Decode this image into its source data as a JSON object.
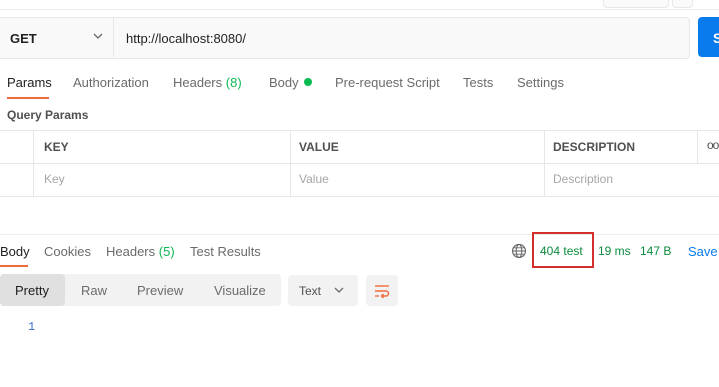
{
  "request": {
    "method": "GET",
    "url": "http://localhost:8080/",
    "send_label": "S"
  },
  "request_tabs": [
    {
      "label": "Params",
      "active": true
    },
    {
      "label": "Authorization"
    },
    {
      "label": "Headers",
      "count": "(8)"
    },
    {
      "label": "Body"
    },
    {
      "label": "Pre-request Script"
    },
    {
      "label": "Tests"
    },
    {
      "label": "Settings"
    }
  ],
  "query_params": {
    "title": "Query Params",
    "columns": [
      "KEY",
      "VALUE",
      "DESCRIPTION"
    ],
    "more": "ooo",
    "placeholders": {
      "key": "Key",
      "value": "Value",
      "description": "Description"
    }
  },
  "response_tabs": [
    {
      "label": "Body",
      "active": true
    },
    {
      "label": "Cookies"
    },
    {
      "label": "Headers",
      "count": "(5)"
    },
    {
      "label": "Test Results"
    }
  ],
  "response_meta": {
    "status": "404 test",
    "time": "19 ms",
    "size": "147 B",
    "save": "Save"
  },
  "view_modes": [
    "Pretty",
    "Raw",
    "Preview",
    "Visualize"
  ],
  "format": "Text",
  "body_lines": [
    "1"
  ],
  "icons": {
    "method_dropdown": "chevron-down-icon",
    "globe": "globe-icon",
    "wrap": "wrap-lines-icon",
    "format_dropdown": "chevron-down-icon"
  },
  "colors": {
    "accent_orange": "#f26b3a",
    "send_blue": "#097bed",
    "status_green": "#0b8a3c",
    "highlight_red": "#d32f2f",
    "body_dot_green": "#0cbb52"
  }
}
